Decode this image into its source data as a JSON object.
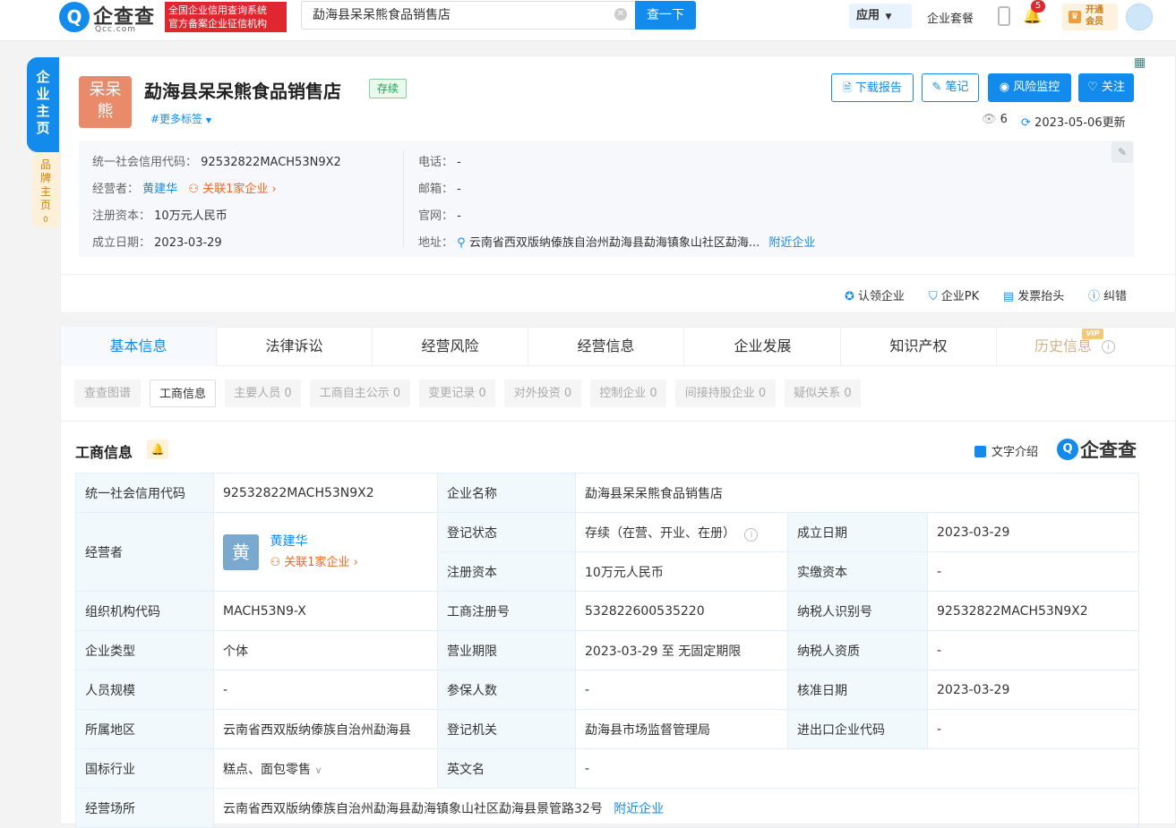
{
  "header": {
    "logo_mark": "Q",
    "logo_text": "企查查",
    "logo_sub": "Qcc.com",
    "slogan_line1": "全国企业信用查询系统",
    "slogan_line2": "官方备案企业征信机构",
    "search_value": "勐海县呆呆熊食品销售店",
    "search_button": "查一下",
    "app_label": "应用",
    "package_label": "企业套餐",
    "notification_count": "5",
    "vip_line1": "开通",
    "vip_line2": "会员"
  },
  "side": {
    "main_tab": "企业主页",
    "brand_tab": "品牌主页",
    "brand_count": "0"
  },
  "company": {
    "logo_text_line1": "呆呆",
    "logo_text_line2": "熊",
    "name": "勐海县呆呆熊食品销售店",
    "status": "存续",
    "more_tags": "#更多标签",
    "actions": {
      "download_report": "下载报告",
      "notes": "笔记",
      "risk_monitor": "风险监控",
      "follow": "关注"
    },
    "view_count": "6",
    "updated": "2023-05-06更新",
    "info": {
      "credit_code_label": "统一社会信用代码：",
      "credit_code": "92532822MACH53N9X2",
      "operator_label": "经营者：",
      "operator": "黄建华",
      "related": "关联1家企业",
      "capital_label": "注册资本：",
      "capital": "10万元人民币",
      "founded_label": "成立日期：",
      "founded": "2023-03-29",
      "phone_label": "电话：",
      "phone": "-",
      "email_label": "邮箱：",
      "email": "-",
      "website_label": "官网：",
      "website": "-",
      "address_label": "地址：",
      "address": "云南省西双版纳傣族自治州勐海县勐海镇象山社区勐海...",
      "nearby": "附近企业"
    },
    "bottom_actions": {
      "claim": "认领企业",
      "pk": "企业PK",
      "invoice": "发票抬头",
      "correct": "纠错"
    }
  },
  "tabs": [
    "基本信息",
    "法律诉讼",
    "经营风险",
    "经营信息",
    "企业发展",
    "知识产权",
    "历史信息"
  ],
  "vip_badge": "VIP",
  "subtabs": [
    "查查图谱",
    "工商信息",
    "主要人员 0",
    "工商自主公示 0",
    "变更记录 0",
    "对外投资 0",
    "控制企业 0",
    "间接持股企业 0",
    "疑似关系 0"
  ],
  "section": {
    "title": "工商信息",
    "text_intro": "文字介绍",
    "brand_logo": "企查查"
  },
  "table": {
    "credit_code_h": "统一社会信用代码",
    "credit_code": "92532822MACH53N9X2",
    "company_name_h": "企业名称",
    "company_name": "勐海县呆呆熊食品销售店",
    "operator_h": "经营者",
    "operator_avatar": "黄",
    "operator": "黄建华",
    "operator_related": "关联1家企业",
    "reg_status_h": "登记状态",
    "reg_status": "存续（在营、开业、在册）",
    "founded_h": "成立日期",
    "founded": "2023-03-29",
    "capital_h": "注册资本",
    "capital": "10万元人民币",
    "paid_capital_h": "实缴资本",
    "paid_capital": "-",
    "org_code_h": "组织机构代码",
    "org_code": "MACH53N9-X",
    "reg_no_h": "工商注册号",
    "reg_no": "532822600535220",
    "tax_id_h": "纳税人识别号",
    "tax_id": "92532822MACH53N9X2",
    "type_h": "企业类型",
    "type": "个体",
    "term_h": "营业期限",
    "term": "2023-03-29 至 无固定期限",
    "taxpayer_h": "纳税人资质",
    "taxpayer": "-",
    "staff_h": "人员规模",
    "staff": "-",
    "insured_h": "参保人数",
    "insured": "-",
    "approved_h": "核准日期",
    "approved": "2023-03-29",
    "region_h": "所属地区",
    "region": "云南省西双版纳傣族自治州勐海县",
    "authority_h": "登记机关",
    "authority": "勐海县市场监督管理局",
    "import_code_h": "进出口企业代码",
    "import_code": "-",
    "industry_h": "国标行业",
    "industry": "糕点、面包零售",
    "english_h": "英文名",
    "english": "-",
    "address_h": "经营场所",
    "address": "云南省西双版纳傣族自治州勐海县勐海镇象山社区勐海县景管路32号",
    "address_nearby": "附近企业"
  },
  "colors": {
    "accent": "#128bed",
    "orange": "#f4661e",
    "status_green": "#1f9e4c",
    "logo_bg": "#e98a6a"
  }
}
